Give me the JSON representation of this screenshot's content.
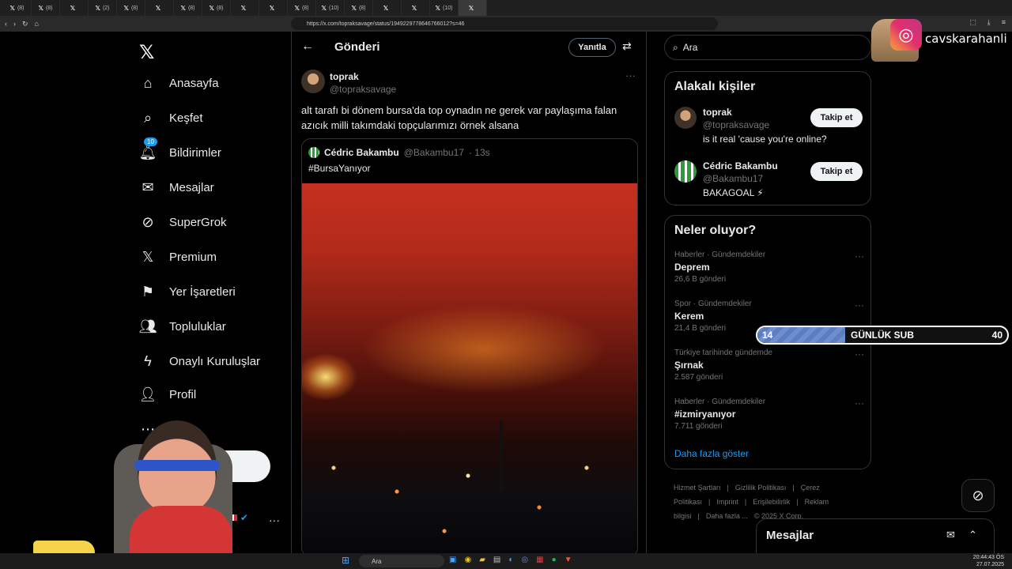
{
  "browser": {
    "tabs": [
      {
        "label": "(8)",
        "active": false
      },
      {
        "label": "(8)",
        "active": false
      },
      {
        "label": "",
        "active": false
      },
      {
        "label": "(2)",
        "active": false
      },
      {
        "label": "(8)",
        "active": false
      },
      {
        "label": "",
        "active": false
      },
      {
        "label": "(8)",
        "active": false
      },
      {
        "label": "(8)",
        "active": false
      },
      {
        "label": "",
        "active": false
      },
      {
        "label": "",
        "active": false
      },
      {
        "label": "(8)",
        "active": false
      },
      {
        "label": "(10)",
        "active": false
      },
      {
        "label": "(8)",
        "active": false
      },
      {
        "label": "",
        "active": false
      },
      {
        "label": "",
        "active": false
      },
      {
        "label": "(10)",
        "active": false
      },
      {
        "label": "",
        "active": true
      }
    ],
    "url": "https://x.com/topraksavage/status/1949229778646766012?s=46"
  },
  "nav": {
    "items": [
      {
        "label": "Anasayfa",
        "icon": "home-icon"
      },
      {
        "label": "Keşfet",
        "icon": "search-icon"
      },
      {
        "label": "Bildirimler",
        "icon": "bell-icon",
        "badge": "10"
      },
      {
        "label": "Mesajlar",
        "icon": "mail-icon"
      },
      {
        "label": "SuperGrok",
        "icon": "grok-icon"
      },
      {
        "label": "Premium",
        "icon": "x-icon"
      },
      {
        "label": "Yer İşaretleri",
        "icon": "bookmark-icon"
      },
      {
        "label": "Topluluklar",
        "icon": "communities-icon"
      },
      {
        "label": "Onaylı Kuruluşlar",
        "icon": "lightning-icon"
      },
      {
        "label": "Profil",
        "icon": "profile-icon"
      },
      {
        "label": "a",
        "icon": "more-icon"
      }
    ],
    "post_label": "ınla",
    "account_name": "nli"
  },
  "post": {
    "header_title": "Gönderi",
    "reply_label": "Yanıtla",
    "author_name": "toprak",
    "author_handle": "@topraksavage",
    "text": "alt tarafı bi dönem bursa'da top oynadın ne gerek var paylaşıma falan azıcık milli takımdaki topçularımızı örnek alsana",
    "quote": {
      "author_name": "Cédric Bakambu",
      "author_handle": "@Bakambu17",
      "time": "· 13s",
      "text": "#BursaYanıyor"
    }
  },
  "search": {
    "placeholder": "Ara"
  },
  "related": {
    "title": "Alakalı kişiler",
    "follow_label": "Takip et",
    "people": [
      {
        "name": "toprak",
        "handle": "@topraksavage",
        "bio": "is it real 'cause you're online?"
      },
      {
        "name": "Cédric Bakambu",
        "handle": "@Bakambu17",
        "bio": "BAKAGOAL ⚡"
      }
    ]
  },
  "trends": {
    "title": "Neler oluyor?",
    "items": [
      {
        "context": "Haberler · Gündemdekiler",
        "name": "Deprem",
        "count": "26,6 B gönderi"
      },
      {
        "context": "Spor · Gündemdekiler",
        "name": "Kerem",
        "count": "21,4 B gönderi"
      },
      {
        "context": "Türkiye tarihinde gündemde",
        "name": "Şırnak",
        "count": "2.587 gönderi"
      },
      {
        "context": "Haberler · Gündemdekiler",
        "name": "#izmiryanıyor",
        "count": "7.711 gönderi"
      }
    ],
    "show_more": "Daha fazla göster"
  },
  "footer": {
    "links": [
      "Hizmet Şartları",
      "|",
      "Gizlilik Politikası",
      "|",
      "Çerez Politikası",
      "|",
      "Imprint",
      "|",
      "Erişilebilirlik",
      "|",
      "Reklam bilgisi",
      "|",
      "Daha fazla ...",
      "© 2025 X Corp."
    ]
  },
  "messages": {
    "title": "Mesajlar"
  },
  "overlay": {
    "instagram_handle": "cavskarahanli",
    "sub_current": "14",
    "sub_label": "GÜNLÜK SUB",
    "sub_goal": "40",
    "sub_progress": 0.35
  },
  "taskbar": {
    "search_placeholder": "Ara",
    "time": "20:44:43 ÖS",
    "date": "27.07.2025"
  },
  "colors": {
    "accent": "#1d9bf0",
    "background": "#000000",
    "border": "#2f3336"
  }
}
